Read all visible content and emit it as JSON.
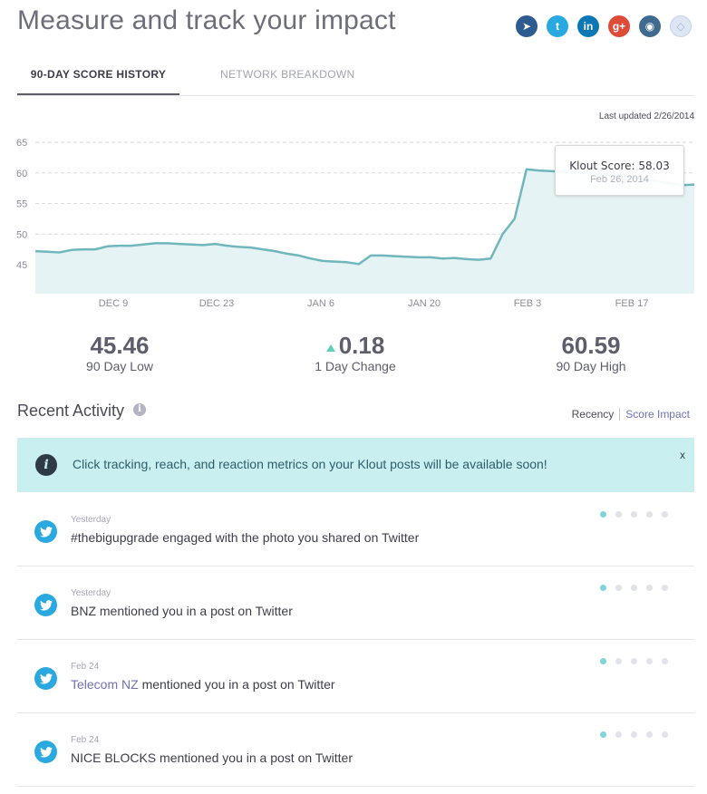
{
  "header": {
    "title": "Measure and track your impact"
  },
  "social_icons": [
    {
      "name": "foursquare-icon",
      "glyph": "➤",
      "color": "#2d5a8f"
    },
    {
      "name": "twitter-icon",
      "glyph": "t",
      "color": "#2aa9e0"
    },
    {
      "name": "linkedin-icon",
      "glyph": "in",
      "color": "#0b77b5"
    },
    {
      "name": "google-plus-icon",
      "glyph": "g+",
      "color": "#dd4b39"
    },
    {
      "name": "instagram-icon",
      "glyph": "◉",
      "color": "#3f6b8f"
    },
    {
      "name": "klout-icon",
      "glyph": "◇",
      "color": "#dfe6f3"
    }
  ],
  "tabs": {
    "active": "90-DAY SCORE HISTORY",
    "inactive": "NETWORK BREAKDOWN"
  },
  "last_updated": "Last updated 2/26/2014",
  "tooltip": {
    "line1": "Klout Score: 58.03",
    "line2": "Feb 26, 2014"
  },
  "chart_data": {
    "type": "area",
    "y_ticks": [
      "65",
      "60",
      "55",
      "50",
      "45"
    ],
    "x_ticks": [
      "DEC 9",
      "DEC 23",
      "JAN 6",
      "JAN 20",
      "FEB 3",
      "FEB 17"
    ],
    "ylim": [
      40,
      65
    ],
    "grid": true,
    "series": [
      {
        "values": [
          47.2,
          47.1,
          47.0,
          47.4,
          47.5,
          47.5,
          48.0,
          48.1,
          48.1,
          48.3,
          48.5,
          48.5,
          48.4,
          48.3,
          48.2,
          48.4,
          48.1,
          47.9,
          47.8,
          47.5,
          47.2,
          46.8,
          46.5,
          46.0,
          45.6,
          45.5,
          45.4,
          45.1,
          46.5,
          46.5,
          46.4,
          46.3,
          46.2,
          46.2,
          46.0,
          46.1,
          45.9,
          45.8,
          46.0,
          50.0,
          52.5,
          60.6,
          60.4,
          60.3,
          60.2,
          60.1,
          60.0,
          59.8,
          59.6,
          59.5,
          59.2,
          58.9,
          58.6,
          58.3,
          58.0,
          58.1
        ],
        "color": "#6fb6bd",
        "fill": "#e6f3f4"
      }
    ]
  },
  "stats": [
    {
      "value": "45.46",
      "label": "90 Day Low"
    },
    {
      "value": "0.18",
      "label": "1 Day Change"
    },
    {
      "value": "60.59",
      "label": "90 Day High"
    }
  ],
  "recent": {
    "title": "Recent Activity",
    "info_glyph": "i",
    "sort_recency": "Recency",
    "sort_impact": "Score Impact"
  },
  "banner": {
    "icon_glyph": "i",
    "text": "Click tracking, reach, and reaction metrics on your Klout posts will be available soon!",
    "close": "x"
  },
  "activity": [
    {
      "when": "Yesterday",
      "link": "",
      "text": "#thebigupgrade engaged with the photo you shared on Twitter",
      "impact_level": 1
    },
    {
      "when": "Yesterday",
      "link": "",
      "text": "BNZ mentioned you in a post on Twitter",
      "impact_level": 1
    },
    {
      "when": "Feb 24",
      "link": "Telecom NZ",
      "text": " mentioned you in a post on Twitter",
      "impact_level": 1
    },
    {
      "when": "Feb 24",
      "link": "",
      "text": "NICE BLOCKS mentioned you in a post on Twitter",
      "impact_level": 1
    }
  ]
}
